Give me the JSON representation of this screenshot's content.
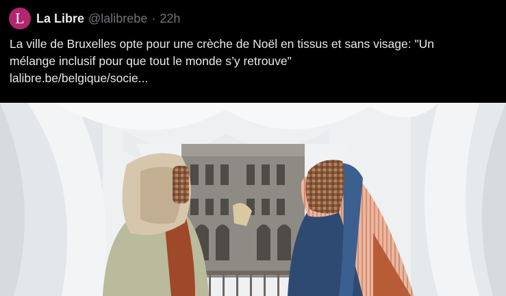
{
  "tweet": {
    "avatar_letter": "L",
    "author_name": "La Libre",
    "author_handle": "@lalibrebe",
    "separator": "·",
    "timestamp": "22h",
    "text_line1": "La ville de Bruxelles opte pour une crèche de Noël en tissus et sans visage: \"Un",
    "text_line2": "mélange inclusif pour que tout le monde s’y retrouve\"",
    "link": "lalibre.be/belgique/socie..."
  },
  "colors": {
    "avatar_bg": "#b3256e",
    "text": "#e7e9ea",
    "muted": "#71767b",
    "background": "#000000"
  }
}
